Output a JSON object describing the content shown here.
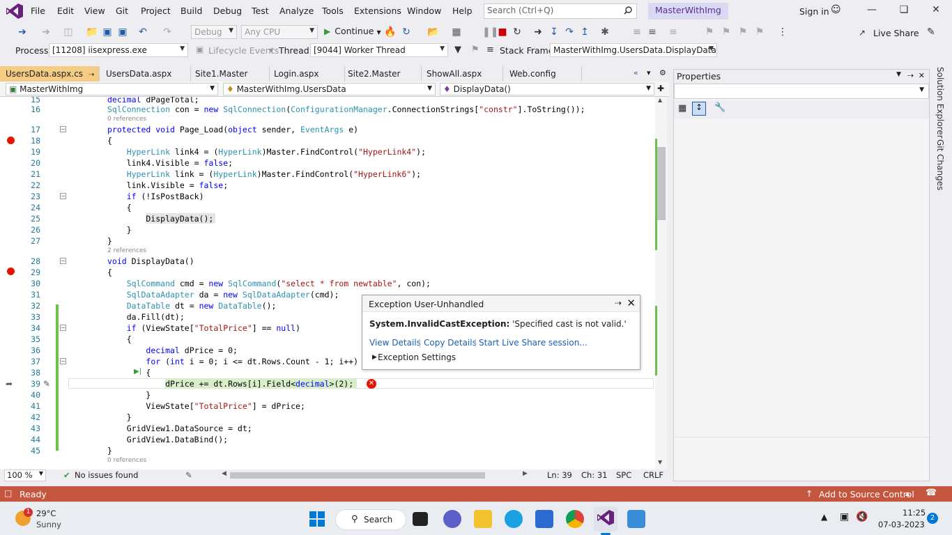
{
  "menu": {
    "items": [
      "File",
      "Edit",
      "View",
      "Git",
      "Project",
      "Build",
      "Debug",
      "Test",
      "Analyze",
      "Tools",
      "Extensions",
      "Window",
      "Help"
    ],
    "search_placeholder": "Search (Ctrl+Q)",
    "solution_name": "MasterWithImg",
    "sign_in": "Sign in"
  },
  "toolbar": {
    "config": "Debug",
    "platform": "Any CPU",
    "continue_label": "Continue",
    "live_share": "Live Share"
  },
  "debugbar": {
    "process_label": "Process:",
    "process_value": "[11208] iisexpress.exe",
    "lifecycle_label": "Lifecycle Events",
    "thread_label": "Thread:",
    "thread_value": "[9044] Worker Thread",
    "stackframe_label": "Stack Frame:",
    "stackframe_value": "MasterWithImg.UsersData.DisplayData"
  },
  "tabs": [
    {
      "label": "UsersData.aspx.cs",
      "active": true
    },
    {
      "label": "UsersData.aspx"
    },
    {
      "label": "Site1.Master"
    },
    {
      "label": "Login.aspx"
    },
    {
      "label": "Site2.Master"
    },
    {
      "label": "ShowAll.aspx"
    },
    {
      "label": "Web.config"
    }
  ],
  "navbar": {
    "project": "MasterWithImg",
    "class": "MasterWithImg.UsersData",
    "member": "DisplayData()"
  },
  "properties": {
    "title": "Properties"
  },
  "sidetabs": [
    "Solution Explorer",
    "Git Changes"
  ],
  "code": {
    "lines": [
      {
        "n": "15",
        "t": "decimal dPageTotal;"
      },
      {
        "n": "16",
        "t": "SqlConnection con = new SqlConnection(ConfigurationManager.ConnectionStrings[\"constr\"].ToString());"
      },
      {
        "ref": "0 references"
      },
      {
        "n": "17",
        "t": "protected void Page_Load(object sender, EventArgs e)"
      },
      {
        "n": "18",
        "t": "{"
      },
      {
        "n": "19",
        "t": "    HyperLink link4 = (HyperLink)Master.FindControl(\"HyperLink4\");"
      },
      {
        "n": "20",
        "t": "    link4.Visible = false;"
      },
      {
        "n": "21",
        "t": "    HyperLink link = (HyperLink)Master.FindControl(\"HyperLink6\");"
      },
      {
        "n": "22",
        "t": "    link.Visible = false;"
      },
      {
        "n": "23",
        "t": "    if (!IsPostBack)"
      },
      {
        "n": "24",
        "t": "    {"
      },
      {
        "n": "25",
        "t": "        DisplayData();"
      },
      {
        "n": "26",
        "t": "    }"
      },
      {
        "n": "27",
        "t": "}"
      },
      {
        "ref": "2 references"
      },
      {
        "n": "28",
        "t": "void DisplayData()"
      },
      {
        "n": "29",
        "t": "{"
      },
      {
        "n": "30",
        "t": "    SqlCommand cmd = new SqlCommand(\"select * from newtable\", con);"
      },
      {
        "n": "31",
        "t": "    SqlDataAdapter da = new SqlDataAdapter(cmd);"
      },
      {
        "n": "32",
        "t": "    DataTable dt = new DataTable();"
      },
      {
        "n": "33",
        "t": "    da.Fill(dt);"
      },
      {
        "n": "34",
        "t": "    if (ViewState[\"TotalPrice\"] == null)"
      },
      {
        "n": "35",
        "t": "    {"
      },
      {
        "n": "36",
        "t": "        decimal dPrice = 0;"
      },
      {
        "n": "37",
        "t": "        for (int i = 0; i <= dt.Rows.Count - 1; i++)"
      },
      {
        "n": "38",
        "t": "        {"
      },
      {
        "n": "39",
        "t": "            dPrice += dt.Rows[i].Field<decimal>(2);"
      },
      {
        "n": "40",
        "t": "        }"
      },
      {
        "n": "41",
        "t": "        ViewState[\"TotalPrice\"] = dPrice;"
      },
      {
        "n": "42",
        "t": "    }"
      },
      {
        "n": "43",
        "t": "    GridView1.DataSource = dt;"
      },
      {
        "n": "44",
        "t": "    GridView1.DataBind();"
      },
      {
        "n": "45",
        "t": "}"
      },
      {
        "ref": "0 references"
      }
    ]
  },
  "exception": {
    "title": "Exception User-Unhandled",
    "type": "System.InvalidCastException:",
    "message": "'Specified cast is not valid.'",
    "view_details": "View Details",
    "copy_details": "Copy Details",
    "live_share": "Start Live Share session...",
    "settings": "Exception Settings"
  },
  "editor_status": {
    "zoom": "100 %",
    "issues": "No issues found",
    "ln": "Ln: 39",
    "ch": "Ch: 31",
    "spc": "SPC",
    "crlf": "CRLF"
  },
  "statusbar": {
    "ready": "Ready",
    "source_control": "Add to Source Control"
  },
  "taskbar": {
    "weather_temp": "29°C",
    "weather_desc": "Sunny",
    "weather_badge": "1",
    "search_label": "Search",
    "time": "11:25",
    "date": "07-03-2023",
    "notif_count": "2"
  },
  "colors": {
    "accent": "#68217a",
    "status": "#c6553f",
    "active_tab": "#f5cc84",
    "breakpoint": "#e51400"
  }
}
